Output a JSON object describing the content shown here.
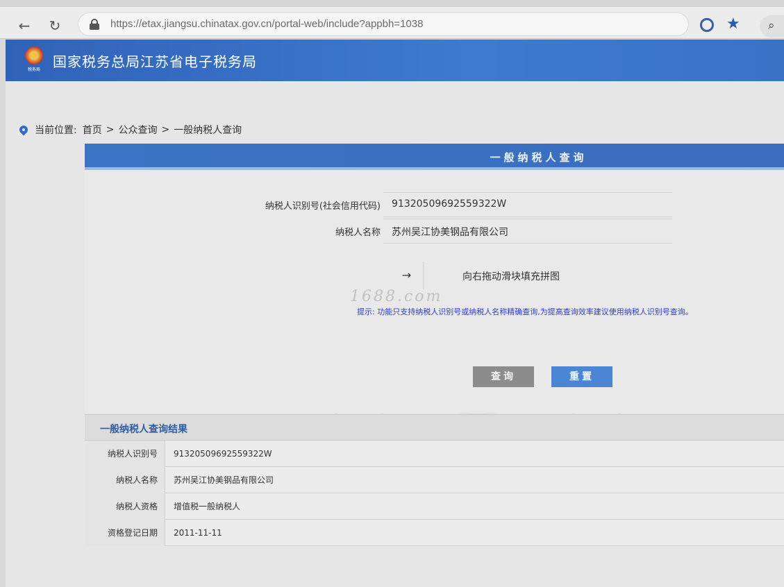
{
  "browser": {
    "url": "https://etax.jiangsu.chinatax.gov.cn/portal-web/include?appbh=1038"
  },
  "header": {
    "emblem_caption": "税务局",
    "title": "国家税务总局江苏省电子税务局"
  },
  "breadcrumb": {
    "label": "当前位置:",
    "items": [
      "首页",
      "公众查询",
      "一般纳税人查询"
    ],
    "separator": ">"
  },
  "query_panel": {
    "title": "一般纳税人查询",
    "fields": [
      {
        "label": "纳税人识别号(社会信用代码)",
        "value": "91320509692559322W"
      },
      {
        "label": "纳税人名称",
        "value": "苏州吴江协美钢品有限公司"
      }
    ],
    "slider_arrow": "→",
    "slider_text": "向右拖动滑块填充拼图",
    "watermark": "1688.com",
    "hint": "提示: 功能只支持纳税人识别号或纳税人名称精确查询,为提高查询效率建议使用纳税人识别号查询。",
    "query_button": "查询",
    "reset_button": "重置"
  },
  "results": {
    "title": "一般纳税人查询结果",
    "rows": [
      {
        "label": "纳税人识别号",
        "value": "91320509692559322W"
      },
      {
        "label": "纳税人名称",
        "value": "苏州吴江协美钢品有限公司"
      },
      {
        "label": "纳税人资格",
        "value": "增值税一般纳税人"
      },
      {
        "label": "资格登记日期",
        "value": "2011-11-11"
      }
    ]
  },
  "colors": {
    "header_blue": "#3a6fc4",
    "hint_blue": "#2b3bd0",
    "reset_blue": "#4a86d3",
    "query_gray": "#8c8c8c"
  }
}
